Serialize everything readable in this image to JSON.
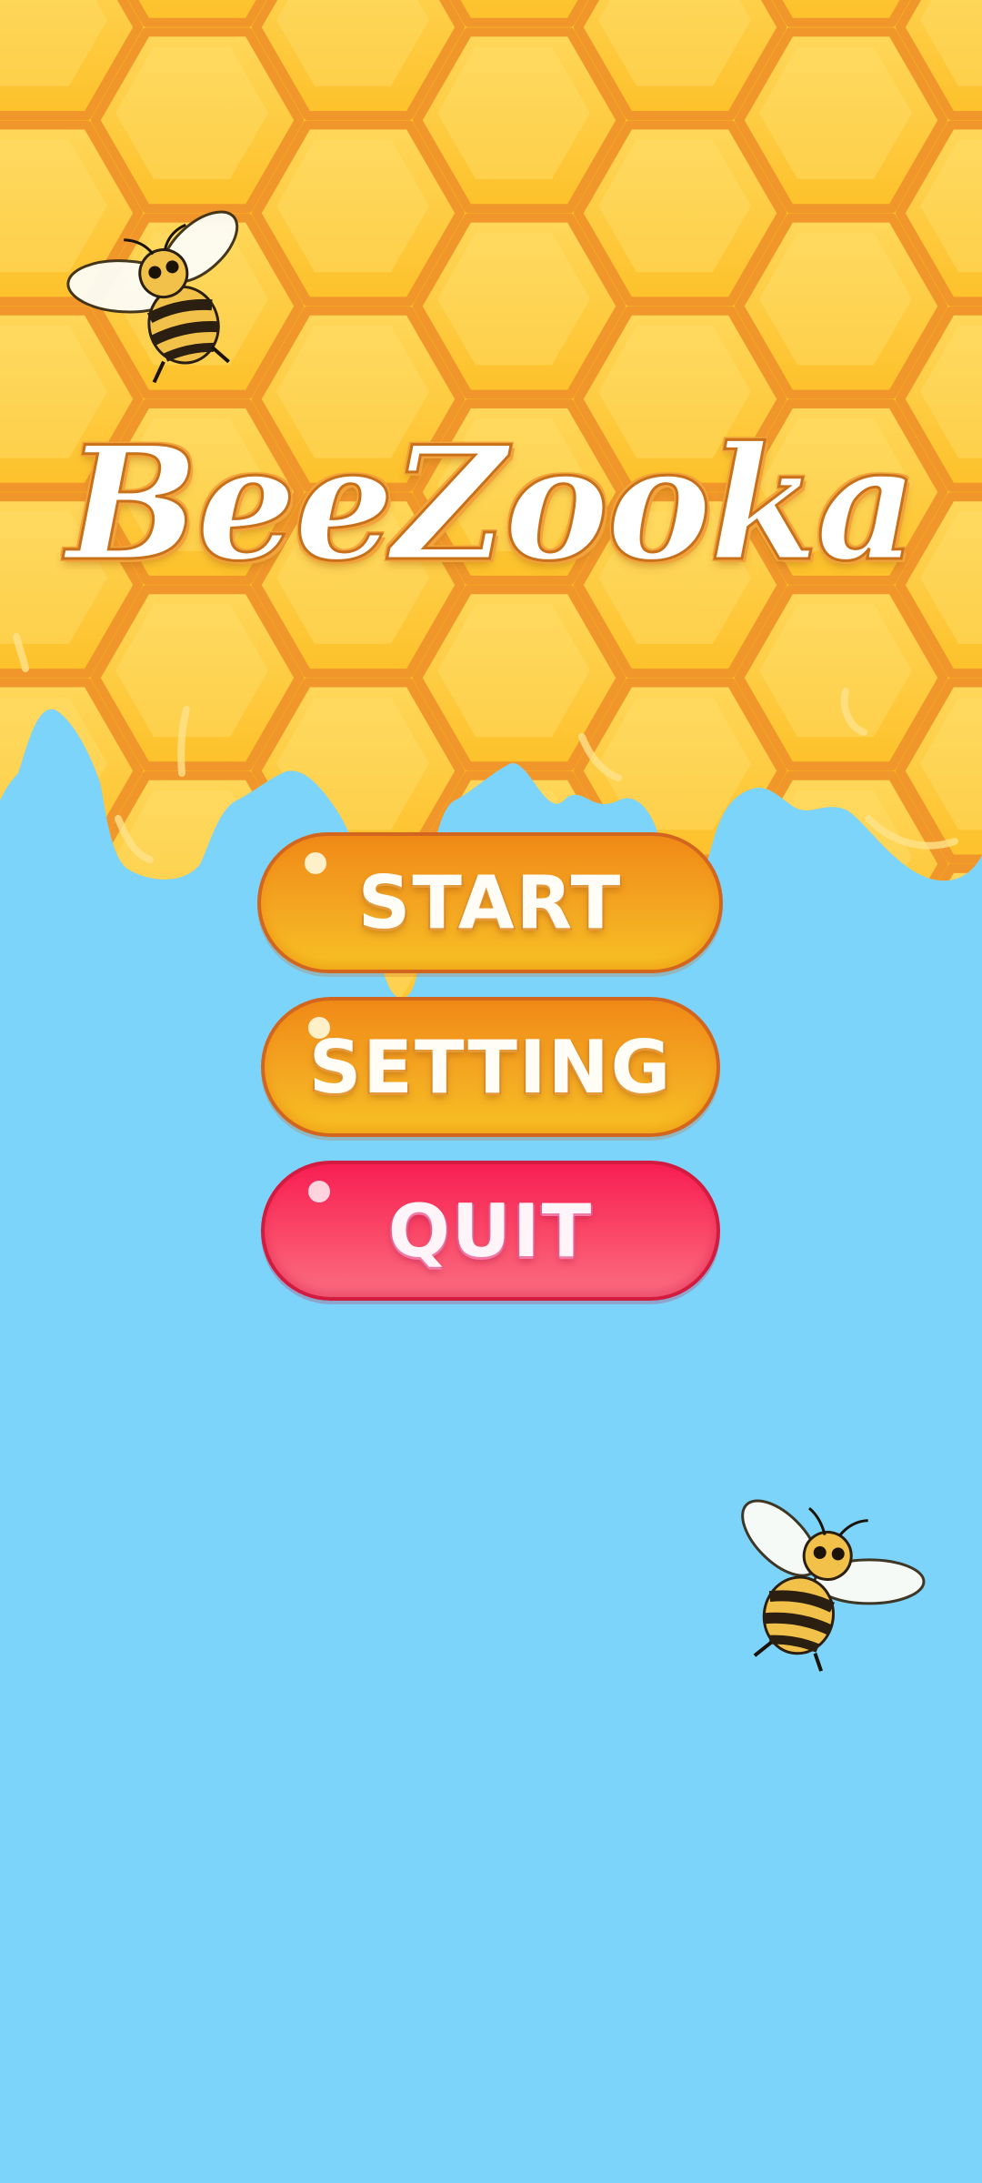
{
  "app": {
    "title": "BeeZooka"
  },
  "menu": {
    "start_label": "START",
    "setting_label": "SETTING",
    "quit_label": "QUIT"
  },
  "colors": {
    "sky": "#7dd4fb",
    "honey": "#fdc623",
    "honeycomb_border": "#f0962a",
    "button_orange": "#f4a722",
    "button_pink": "#fa4a69"
  },
  "icons": [
    "bee-icon",
    "bee-icon"
  ]
}
